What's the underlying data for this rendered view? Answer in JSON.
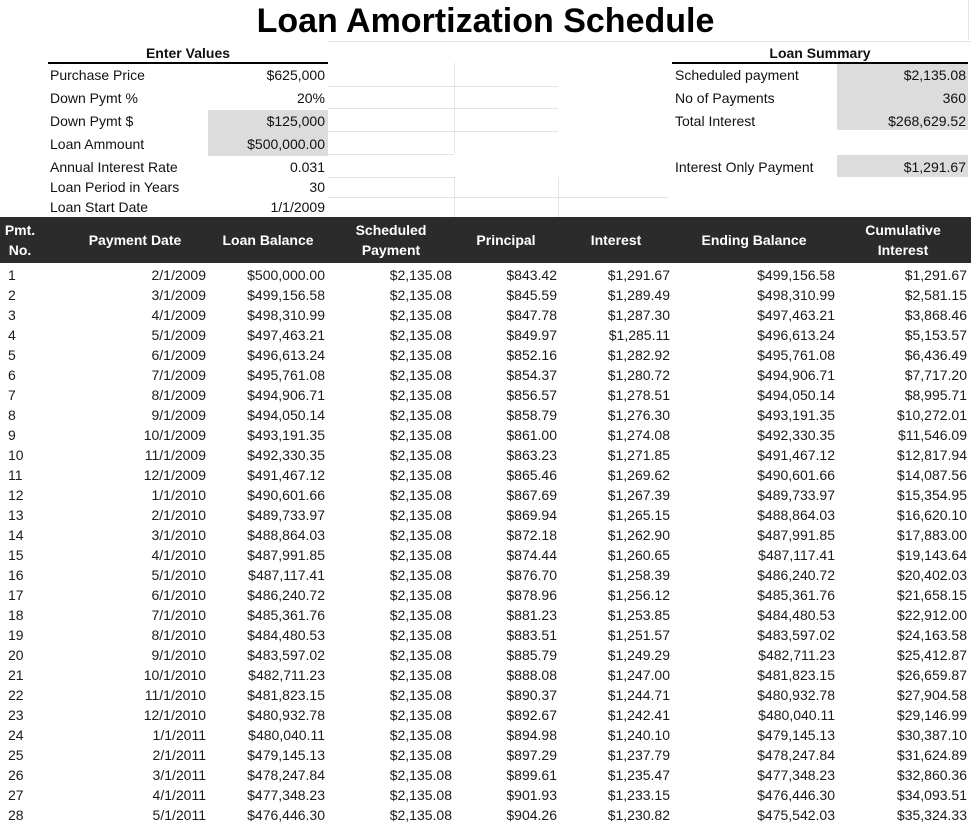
{
  "title": "Loan Amortization Schedule",
  "enter_values": {
    "heading": "Enter Values",
    "rows": [
      {
        "label": "Purchase Price",
        "value": "$625,000",
        "shaded": false
      },
      {
        "label": "Down Pymt %",
        "value": "20%",
        "shaded": false
      },
      {
        "label": "Down Pymt $",
        "value": "$125,000",
        "shaded": true
      },
      {
        "label": "Loan Ammount",
        "value": "$500,000.00",
        "shaded": true
      },
      {
        "label": "Annual Interest Rate",
        "value": "0.031",
        "shaded": false
      },
      {
        "label": "Loan Period in Years",
        "value": "30",
        "shaded": false
      },
      {
        "label": "Loan Start Date",
        "value": "1/1/2009",
        "shaded": false
      }
    ]
  },
  "loan_summary": {
    "heading": "Loan Summary",
    "rows": [
      {
        "label": "Scheduled payment",
        "value": "$2,135.08"
      },
      {
        "label": "No of Payments",
        "value": "360"
      },
      {
        "label": "Total Interest",
        "value": "$268,629.52"
      }
    ],
    "interest_only": {
      "label": "Interest Only Payment",
      "value": "$1,291.67"
    }
  },
  "table": {
    "headers": [
      {
        "line1": "Pmt.",
        "line2": "No."
      },
      {
        "line1": "Payment Date",
        "line2": ""
      },
      {
        "line1": "Loan Balance",
        "line2": ""
      },
      {
        "line1": "Scheduled",
        "line2": "Payment"
      },
      {
        "line1": "Principal",
        "line2": ""
      },
      {
        "line1": "Interest",
        "line2": ""
      },
      {
        "line1": "Ending Balance",
        "line2": ""
      },
      {
        "line1": "Cumulative",
        "line2": "Interest"
      }
    ],
    "rows": [
      [
        "1",
        "2/1/2009",
        "$500,000.00",
        "$2,135.08",
        "$843.42",
        "$1,291.67",
        "$499,156.58",
        "$1,291.67"
      ],
      [
        "2",
        "3/1/2009",
        "$499,156.58",
        "$2,135.08",
        "$845.59",
        "$1,289.49",
        "$498,310.99",
        "$2,581.15"
      ],
      [
        "3",
        "4/1/2009",
        "$498,310.99",
        "$2,135.08",
        "$847.78",
        "$1,287.30",
        "$497,463.21",
        "$3,868.46"
      ],
      [
        "4",
        "5/1/2009",
        "$497,463.21",
        "$2,135.08",
        "$849.97",
        "$1,285.11",
        "$496,613.24",
        "$5,153.57"
      ],
      [
        "5",
        "6/1/2009",
        "$496,613.24",
        "$2,135.08",
        "$852.16",
        "$1,282.92",
        "$495,761.08",
        "$6,436.49"
      ],
      [
        "6",
        "7/1/2009",
        "$495,761.08",
        "$2,135.08",
        "$854.37",
        "$1,280.72",
        "$494,906.71",
        "$7,717.20"
      ],
      [
        "7",
        "8/1/2009",
        "$494,906.71",
        "$2,135.08",
        "$856.57",
        "$1,278.51",
        "$494,050.14",
        "$8,995.71"
      ],
      [
        "8",
        "9/1/2009",
        "$494,050.14",
        "$2,135.08",
        "$858.79",
        "$1,276.30",
        "$493,191.35",
        "$10,272.01"
      ],
      [
        "9",
        "10/1/2009",
        "$493,191.35",
        "$2,135.08",
        "$861.00",
        "$1,274.08",
        "$492,330.35",
        "$11,546.09"
      ],
      [
        "10",
        "11/1/2009",
        "$492,330.35",
        "$2,135.08",
        "$863.23",
        "$1,271.85",
        "$491,467.12",
        "$12,817.94"
      ],
      [
        "11",
        "12/1/2009",
        "$491,467.12",
        "$2,135.08",
        "$865.46",
        "$1,269.62",
        "$490,601.66",
        "$14,087.56"
      ],
      [
        "12",
        "1/1/2010",
        "$490,601.66",
        "$2,135.08",
        "$867.69",
        "$1,267.39",
        "$489,733.97",
        "$15,354.95"
      ],
      [
        "13",
        "2/1/2010",
        "$489,733.97",
        "$2,135.08",
        "$869.94",
        "$1,265.15",
        "$488,864.03",
        "$16,620.10"
      ],
      [
        "14",
        "3/1/2010",
        "$488,864.03",
        "$2,135.08",
        "$872.18",
        "$1,262.90",
        "$487,991.85",
        "$17,883.00"
      ],
      [
        "15",
        "4/1/2010",
        "$487,991.85",
        "$2,135.08",
        "$874.44",
        "$1,260.65",
        "$487,117.41",
        "$19,143.64"
      ],
      [
        "16",
        "5/1/2010",
        "$487,117.41",
        "$2,135.08",
        "$876.70",
        "$1,258.39",
        "$486,240.72",
        "$20,402.03"
      ],
      [
        "17",
        "6/1/2010",
        "$486,240.72",
        "$2,135.08",
        "$878.96",
        "$1,256.12",
        "$485,361.76",
        "$21,658.15"
      ],
      [
        "18",
        "7/1/2010",
        "$485,361.76",
        "$2,135.08",
        "$881.23",
        "$1,253.85",
        "$484,480.53",
        "$22,912.00"
      ],
      [
        "19",
        "8/1/2010",
        "$484,480.53",
        "$2,135.08",
        "$883.51",
        "$1,251.57",
        "$483,597.02",
        "$24,163.58"
      ],
      [
        "20",
        "9/1/2010",
        "$483,597.02",
        "$2,135.08",
        "$885.79",
        "$1,249.29",
        "$482,711.23",
        "$25,412.87"
      ],
      [
        "21",
        "10/1/2010",
        "$482,711.23",
        "$2,135.08",
        "$888.08",
        "$1,247.00",
        "$481,823.15",
        "$26,659.87"
      ],
      [
        "22",
        "11/1/2010",
        "$481,823.15",
        "$2,135.08",
        "$890.37",
        "$1,244.71",
        "$480,932.78",
        "$27,904.58"
      ],
      [
        "23",
        "12/1/2010",
        "$480,932.78",
        "$2,135.08",
        "$892.67",
        "$1,242.41",
        "$480,040.11",
        "$29,146.99"
      ],
      [
        "24",
        "1/1/2011",
        "$480,040.11",
        "$2,135.08",
        "$894.98",
        "$1,240.10",
        "$479,145.13",
        "$30,387.10"
      ],
      [
        "25",
        "2/1/2011",
        "$479,145.13",
        "$2,135.08",
        "$897.29",
        "$1,237.79",
        "$478,247.84",
        "$31,624.89"
      ],
      [
        "26",
        "3/1/2011",
        "$478,247.84",
        "$2,135.08",
        "$899.61",
        "$1,235.47",
        "$477,348.23",
        "$32,860.36"
      ],
      [
        "27",
        "4/1/2011",
        "$477,348.23",
        "$2,135.08",
        "$901.93",
        "$1,233.15",
        "$476,446.30",
        "$34,093.51"
      ],
      [
        "28",
        "5/1/2011",
        "$476,446.30",
        "$2,135.08",
        "$904.26",
        "$1,230.82",
        "$475,542.03",
        "$35,324.33"
      ]
    ]
  }
}
